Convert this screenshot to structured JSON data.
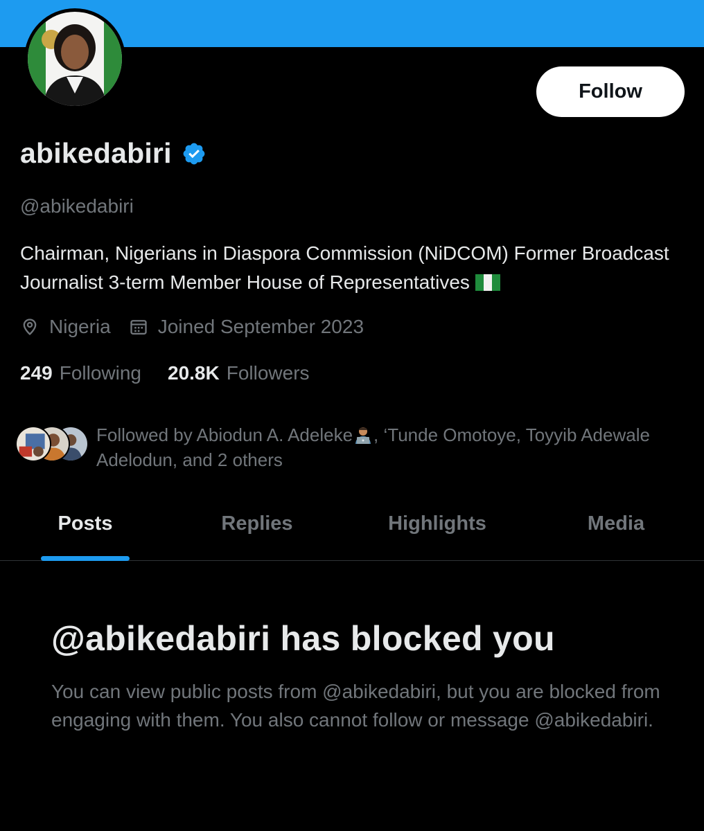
{
  "header": {
    "banner_color": "#1d9bf0"
  },
  "profile": {
    "display_name": "abikedabiri",
    "verified": true,
    "verified_color": "#1d9bf0",
    "handle": "@abikedabiri",
    "bio": "Chairman, Nigerians in Diaspora Commission (NiDCOM) Former Broadcast Journalist 3-term Member House of Representatives",
    "bio_emoji": "nigeria-flag",
    "location": "Nigeria",
    "joined": "Joined September 2023",
    "following_count": "249",
    "following_label": "Following",
    "followers_count": "20.8K",
    "followers_label": "Followers",
    "followed_by_prefix": "Followed by Abiodun A. Adeleke",
    "followed_by_emoji": "technologist-emoji",
    "followed_by_rest": ", ‘Tunde Omotoye, Toyyib Adewale Adelodun, and 2 others"
  },
  "actions": {
    "follow_label": "Follow"
  },
  "tabs": [
    {
      "label": "Posts",
      "active": true
    },
    {
      "label": "Replies",
      "active": false
    },
    {
      "label": "Highlights",
      "active": false
    },
    {
      "label": "Media",
      "active": false
    }
  ],
  "blocked_notice": {
    "title": "@abikedabiri has blocked you",
    "description": "You can view public posts from @abikedabiri, but you are blocked from engaging with them. You also cannot follow or message @abikedabiri."
  },
  "colors": {
    "accent": "#1d9bf0",
    "background": "#000000",
    "primary_text": "#e7e9ea",
    "secondary_text": "#71767b"
  }
}
